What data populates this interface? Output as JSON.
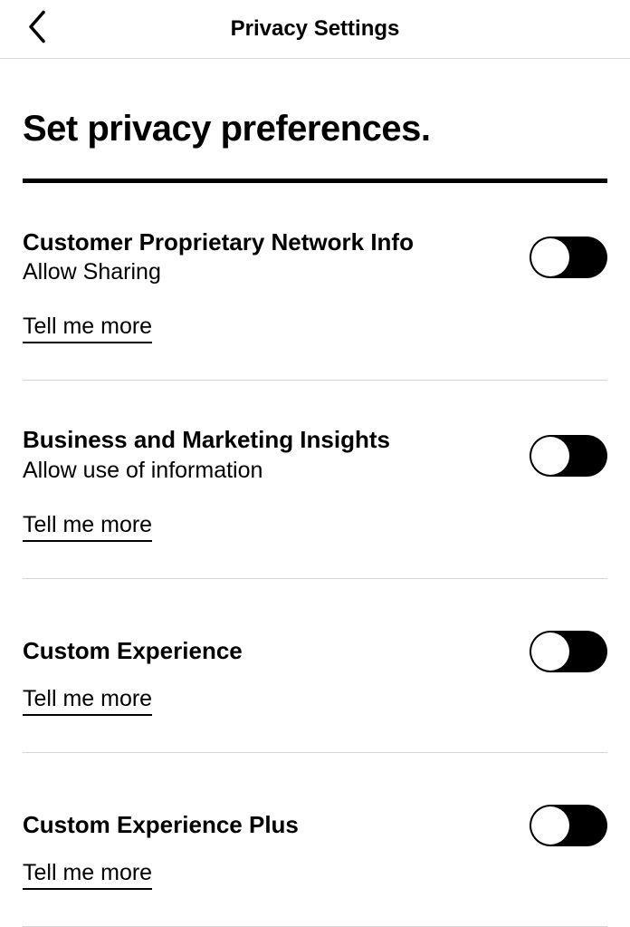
{
  "header": {
    "title": "Privacy Settings"
  },
  "page": {
    "title": "Set privacy preferences."
  },
  "settings": [
    {
      "title": "Customer Proprietary Network Info",
      "sub": "Allow Sharing",
      "more": "Tell me more",
      "on": false
    },
    {
      "title": "Business and Marketing Insights",
      "sub": "Allow use of information",
      "more": "Tell me more",
      "on": false
    },
    {
      "title": "Custom Experience",
      "sub": "",
      "more": "Tell me more",
      "on": false
    },
    {
      "title": "Custom Experience Plus",
      "sub": "",
      "more": "Tell me more",
      "on": false
    }
  ]
}
